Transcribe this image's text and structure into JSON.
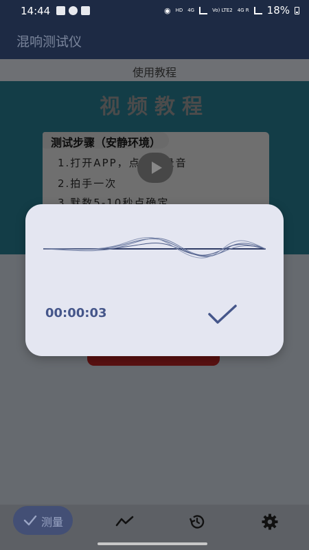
{
  "status_bar": {
    "time": "14:44",
    "indicators": [
      "HD",
      "4G",
      "Vo) LTE2",
      "4G R"
    ],
    "battery": "18%"
  },
  "app_bar": {
    "title": "混响测试仪"
  },
  "section": {
    "title": "使用教程"
  },
  "video": {
    "title": "视频教程",
    "steps_header": "测试步骤（安静环境）",
    "steps": [
      "1.打开APP，点开始录音",
      "2.拍手一次",
      "3.默数5-10秒点确定"
    ]
  },
  "dialog": {
    "timer": "00:00:03",
    "colors": {
      "accent": "#45568a",
      "background": "#e4e6f1"
    }
  },
  "bottom_nav": {
    "items": [
      {
        "label": "测量",
        "icon": "check-icon",
        "active": true
      },
      {
        "label": "",
        "icon": "trend-chart-icon",
        "active": false
      },
      {
        "label": "",
        "icon": "history-icon",
        "active": false
      },
      {
        "label": "",
        "icon": "gear-icon",
        "active": false
      }
    ]
  }
}
